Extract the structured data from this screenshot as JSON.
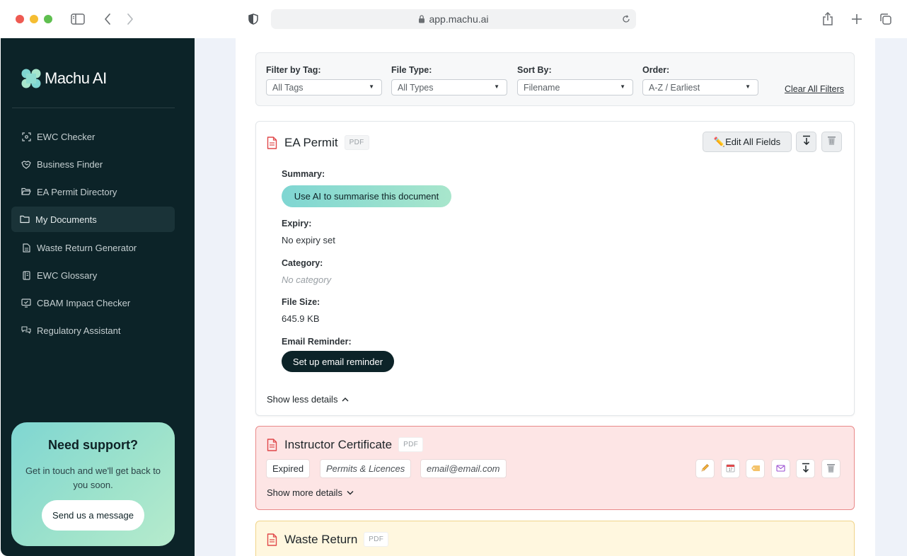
{
  "browser": {
    "url": "app.machu.ai"
  },
  "sidebar": {
    "brand": "Machu AI",
    "items": [
      {
        "label": "EWC Checker",
        "icon": "scan-icon"
      },
      {
        "label": "Business Finder",
        "icon": "handshake-icon"
      },
      {
        "label": "EA Permit Directory",
        "icon": "folder-open-icon"
      },
      {
        "label": "My Documents",
        "icon": "folder-icon"
      },
      {
        "label": "Waste Return Generator",
        "icon": "file-text-icon"
      },
      {
        "label": "EWC Glossary",
        "icon": "book-icon"
      },
      {
        "label": "CBAM Impact Checker",
        "icon": "monitor-check-icon"
      },
      {
        "label": "Regulatory Assistant",
        "icon": "chat-icon"
      }
    ],
    "support": {
      "title": "Need support?",
      "text": "Get in touch and we'll get back to you soon.",
      "button": "Send us a message"
    }
  },
  "filters": {
    "tag": {
      "label": "Filter by Tag:",
      "value": "All Tags"
    },
    "type": {
      "label": "File Type:",
      "value": "All Types"
    },
    "sort": {
      "label": "Sort By:",
      "value": "Filename"
    },
    "order": {
      "label": "Order:",
      "value": "A-Z / Earliest"
    },
    "clear": "Clear All Filters"
  },
  "documents": [
    {
      "title": "EA Permit",
      "badge": "PDF",
      "edit_all": "✏️Edit All Fields",
      "summary_label": "Summary:",
      "summary_button": "Use AI to summarise this document",
      "expiry_label": "Expiry:",
      "expiry_value": "No expiry set",
      "category_label": "Category:",
      "category_value": "No category",
      "size_label": "File Size:",
      "size_value": "645.9 KB",
      "reminder_label": "Email Reminder:",
      "reminder_button": "Set up email reminder",
      "toggle": "Show less details"
    },
    {
      "title": "Instructor Certificate",
      "badge": "PDF",
      "status": "Expired",
      "category": "Permits & Licences",
      "email": "email@email.com",
      "toggle": "Show more details",
      "color": "#fde5e5"
    },
    {
      "title": "Waste Return",
      "badge": "PDF",
      "color": "#fff7df"
    }
  ],
  "colors": {
    "sidebar_bg": "#0c2328",
    "accent_gradient_start": "#7fd6d2",
    "accent_gradient_end": "#a8e6cc",
    "expired_bg": "#fde5e5",
    "expired_border": "#e98a8a",
    "warning_bg": "#fff7df"
  }
}
